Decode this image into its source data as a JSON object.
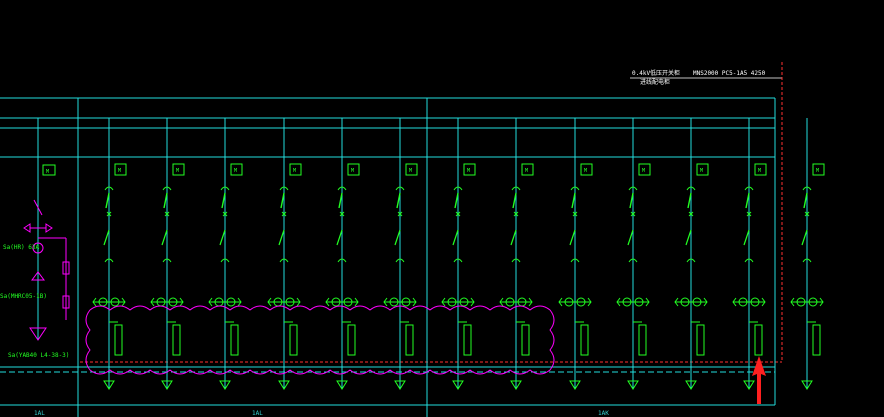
{
  "drawing": {
    "header_left_1": "0.4kV低压开关柜",
    "header_left_2": "进线配电柜",
    "header_right": "MNS2000 PC5-1A5 4250 ",
    "incoming_labels": [
      "Sa(HR) 63A",
      "Sa(MHRC05-1B)",
      "Sa(YAB40 L4-38-3)"
    ],
    "feeder_tag": "M",
    "feeder_count": 13,
    "bottom_labels": [
      "1AL",
      "1AL",
      "1AK"
    ]
  },
  "colors": {
    "background": "#000000",
    "busbar": "#22dddd",
    "feeder": "#22ff22",
    "revision_cloud": "#ff00ff",
    "border_dashed": "#ff3030",
    "pointer_arrow": "#ff2020",
    "text": "#ffffff"
  },
  "pointer": {
    "icon": "arrow-up-icon"
  }
}
